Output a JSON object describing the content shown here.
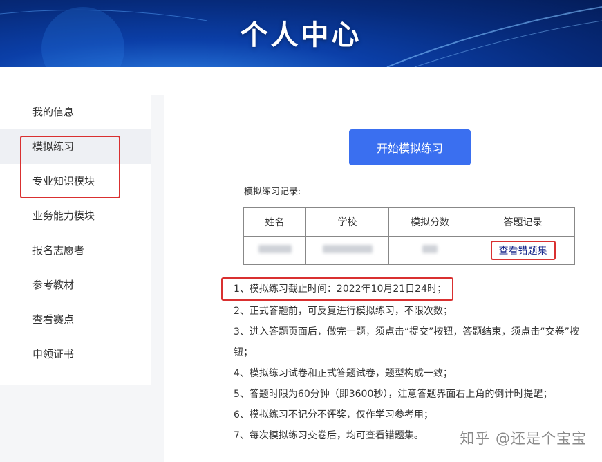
{
  "banner": {
    "title": "个人中心"
  },
  "sidebar": {
    "items": [
      {
        "label": "我的信息"
      },
      {
        "label": "模拟练习"
      },
      {
        "label": "专业知识模块"
      },
      {
        "label": "业务能力模块"
      },
      {
        "label": "报名志愿者"
      },
      {
        "label": "参考教材"
      },
      {
        "label": "查看赛点"
      },
      {
        "label": "申领证书"
      }
    ]
  },
  "main": {
    "start_button": "开始模拟练习",
    "records_label": "模拟练习记录:",
    "table": {
      "headers": [
        "姓名",
        "学校",
        "模拟分数",
        "答题记录"
      ],
      "row": {
        "action": "查看错题集"
      }
    },
    "notes": [
      "1、模拟练习截止时间：2022年10月21日24时；",
      "2、正式答题前，可反复进行模拟练习，不限次数；",
      "3、进入答题页面后，做完一题，须点击“提交”按钮，答题结束，须点击“交卷”按钮；",
      "4、模拟练习试卷和正式答题试卷，题型构成一致；",
      "5、答题时限为60分钟（即3600秒），注意答题界面右上角的倒计时提醒；",
      "6、模拟练习不记分不评奖，仅作学习参考用；",
      "7、每次模拟练习交卷后，均可查看错题集。"
    ]
  },
  "watermark": "知乎 @还是个宝宝",
  "colors": {
    "accent": "#3a6ff0",
    "highlight": "#d93030",
    "banner": "#0b3fa8"
  }
}
